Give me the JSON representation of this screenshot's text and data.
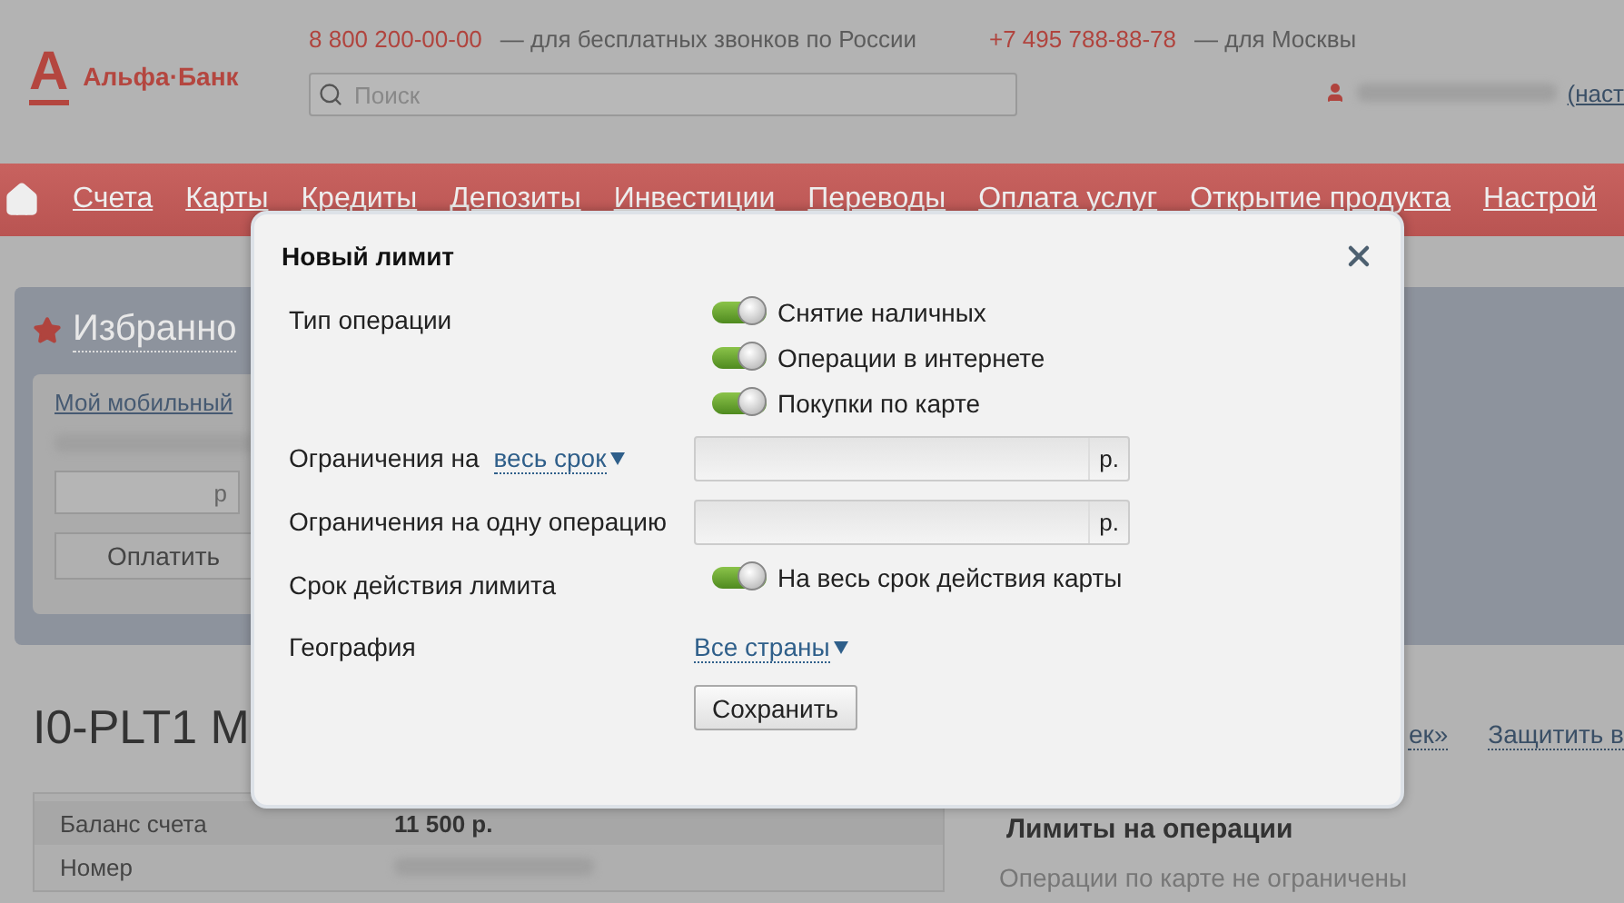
{
  "header": {
    "logo_mark": "А",
    "logo": "Альфа·Банк",
    "phones": [
      {
        "number": "8 800 200-00-00",
        "note": "— для бесплатных звонков по России"
      },
      {
        "number": "+7 495 788-88-78",
        "note": "— для Москвы"
      }
    ],
    "search": {
      "placeholder": "Поиск"
    },
    "user_link": "(наст"
  },
  "nav": [
    "Счета",
    "Карты",
    "Кредиты",
    "Депозиты",
    "Инвестиции",
    "Переводы",
    "Оплата услуг",
    "Открытие продукта",
    "Настрой"
  ],
  "favorites": {
    "title": "Избранно",
    "item": "Мой мобильный",
    "unit": "р",
    "pay_button": "Оплатить"
  },
  "account": {
    "title": "I0-PLT1 M",
    "links": [
      "ек»",
      "Защитить в"
    ],
    "rows": [
      {
        "label": "Баланс счета",
        "value": "11 500 р."
      },
      {
        "label": "Номер"
      }
    ]
  },
  "limits": {
    "title": "Лимиты на операции",
    "text": "Операции по карте не ограничены"
  },
  "dialog": {
    "title": "Новый лимит",
    "rows": [
      {
        "kind": "toggles",
        "label": "Тип операции",
        "toggles": [
          {
            "label": "Снятие наличных",
            "on": true
          },
          {
            "label": "Операции в интернете",
            "on": true
          },
          {
            "label": "Покупки по карте",
            "on": true
          }
        ]
      },
      {
        "kind": "amount",
        "label": "Ограничения на",
        "period": "весь срок",
        "unit": "р."
      },
      {
        "kind": "amount",
        "label": "Ограничения на одну операцию",
        "unit": "р."
      },
      {
        "kind": "toggles",
        "label": "Срок действия лимита",
        "toggles": [
          {
            "label": "На весь срок действия карты",
            "on": true
          }
        ]
      },
      {
        "kind": "select",
        "label": "География",
        "value": "Все страны"
      }
    ],
    "save": "Сохранить"
  }
}
